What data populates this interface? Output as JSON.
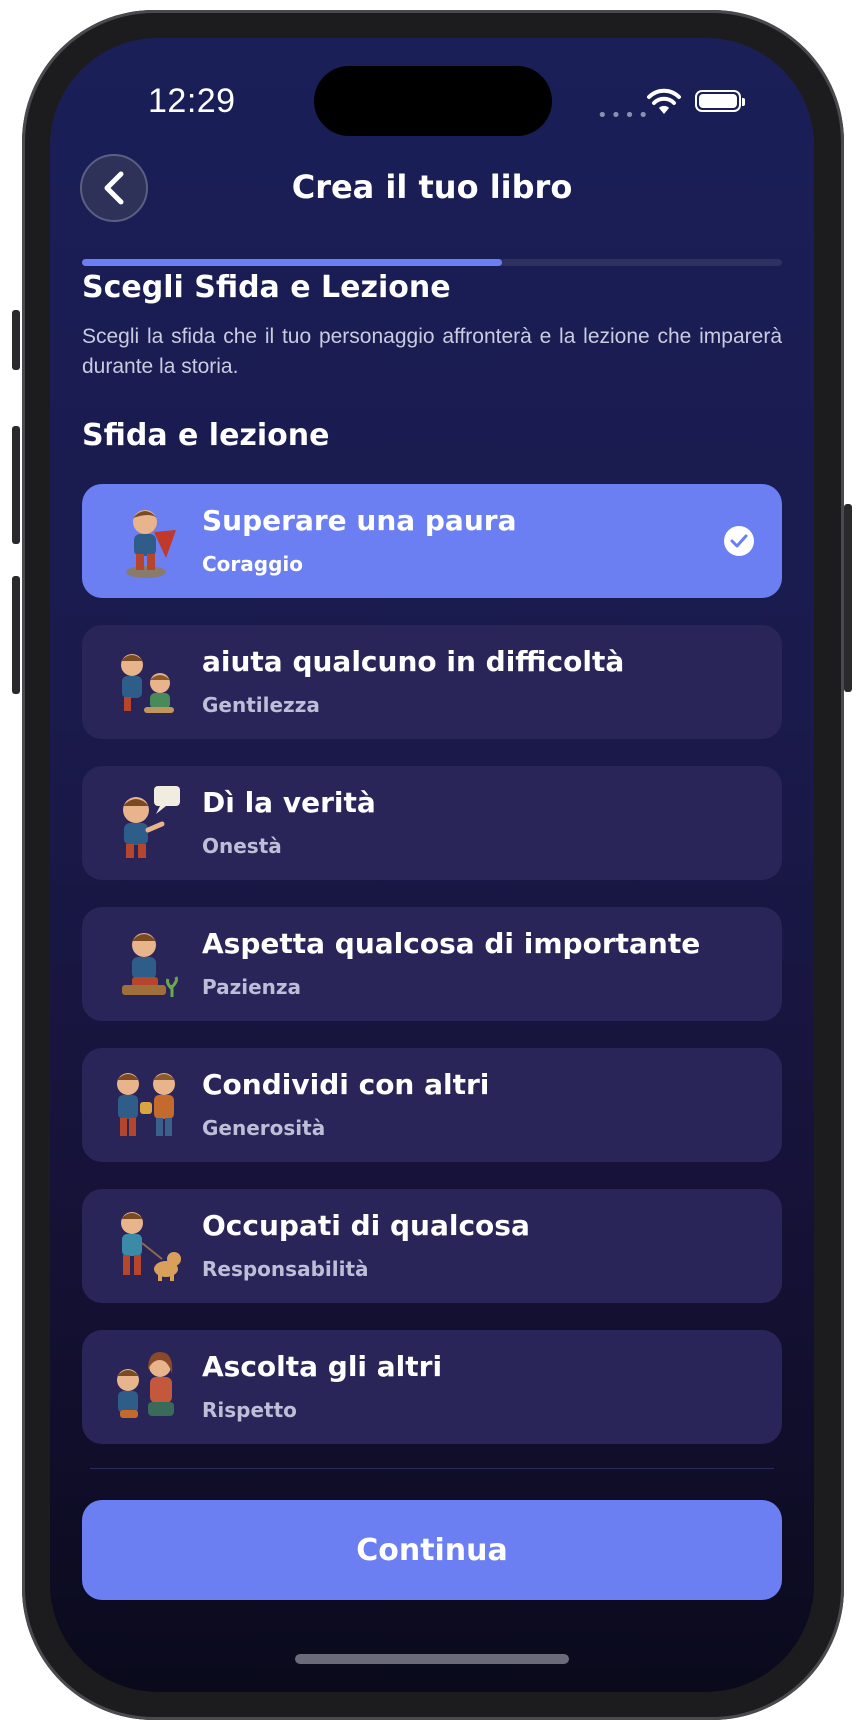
{
  "status_bar": {
    "time": "12:29"
  },
  "header": {
    "title": "Crea il tuo libro"
  },
  "progress": {
    "value": 0.6
  },
  "section": {
    "title": "Scegli Sfida e Lezione",
    "description": "Scegli la sfida che il tuo personaggio affronterà e la lezione che imparerà durante la storia."
  },
  "group": {
    "label": "Sfida e lezione"
  },
  "options": [
    {
      "title": "Superare una paura",
      "subtitle": "Coraggio",
      "selected": true,
      "icon": "child-hero-icon"
    },
    {
      "title": "aiuta qualcuno in difficoltà",
      "subtitle": "Gentilezza",
      "selected": false,
      "icon": "children-helping-icon"
    },
    {
      "title": "Dì la verità",
      "subtitle": "Onestà",
      "selected": false,
      "icon": "child-speech-bubble-icon"
    },
    {
      "title": "Aspetta qualcosa di importante",
      "subtitle": "Pazienza",
      "selected": false,
      "icon": "child-waiting-icon"
    },
    {
      "title": "Condividi con altri",
      "subtitle": "Generosità",
      "selected": false,
      "icon": "children-sharing-icon"
    },
    {
      "title": "Occupati di qualcosa",
      "subtitle": "Responsabilità",
      "selected": false,
      "icon": "child-with-dog-icon"
    },
    {
      "title": "Ascolta gli altri",
      "subtitle": "Rispetto",
      "selected": false,
      "icon": "child-listening-icon"
    }
  ],
  "footer": {
    "continue_label": "Continua"
  },
  "colors": {
    "accent": "#6b7ff2",
    "card": "#2a2558",
    "background_top": "#1a1f58",
    "background_bottom": "#0a0a1c"
  }
}
